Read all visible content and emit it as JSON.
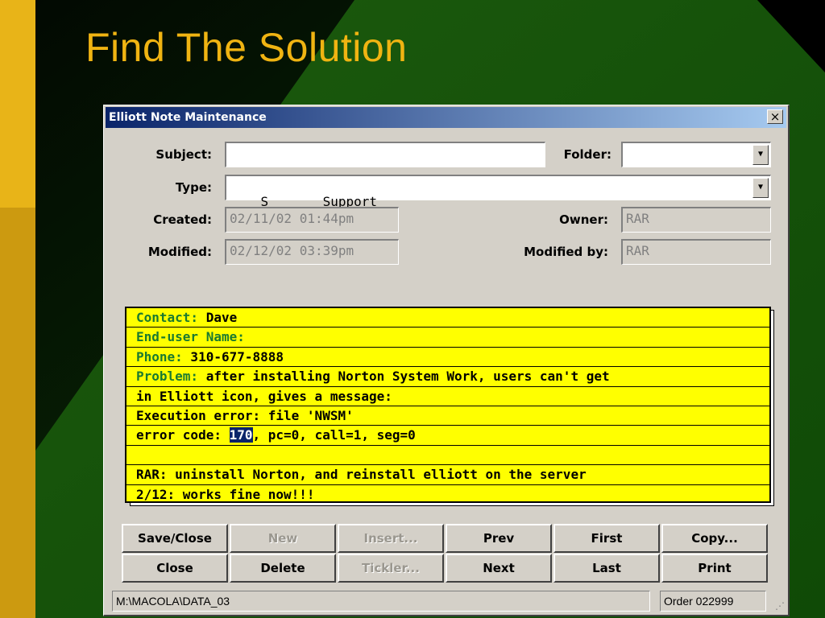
{
  "slide": {
    "title": "Find The Solution"
  },
  "window": {
    "title": "Elliott Note Maintenance",
    "close_glyph": "×"
  },
  "form": {
    "subject_label": "Subject:",
    "subject_value": "",
    "folder_label": "Folder:",
    "folder_value": "",
    "type_label": "Type:",
    "type_value": "S       Support",
    "created_label": "Created:",
    "created_value": "02/11/02 01:44pm",
    "owner_label": "Owner:",
    "owner_value": "RAR",
    "modified_label": "Modified:",
    "modified_value": "02/12/02 03:39pm",
    "modified_by_label": "Modified by:",
    "modified_by_value": "RAR"
  },
  "note": {
    "lines": [
      {
        "key": "Contact:",
        "text": " Dave"
      },
      {
        "key": "End-user Name:",
        "text": ""
      },
      {
        "key": "Phone:",
        "text": " 310-677-8888"
      },
      {
        "key": "Problem:",
        "text": " after installing Norton System Work, users can't get"
      },
      {
        "key": "",
        "text": "in Elliott icon, gives a message:"
      },
      {
        "key": "",
        "text": "Execution error: file 'NWSM'"
      },
      {
        "key": "",
        "text_before": "error code: ",
        "selected": "170",
        "text_after": ", pc=0, call=1, seg=0"
      },
      {
        "key": "",
        "text": ""
      },
      {
        "key": "",
        "text": "RAR: uninstall Norton, and reinstall elliott on the server"
      },
      {
        "key": "",
        "text": "2/12: works fine now!!!"
      }
    ]
  },
  "buttons": {
    "save_close": "Save/Close",
    "new": "New",
    "insert": "Insert...",
    "prev": "Prev",
    "first": "First",
    "copy": "Copy...",
    "close": "Close",
    "delete": "Delete",
    "tickler": "Tickler...",
    "next": "Next",
    "last": "Last",
    "print": "Print"
  },
  "status": {
    "path": "M:\\MACOLA\\DATA_03",
    "order": "Order 022999"
  },
  "colors": {
    "background": "#0a2a08",
    "accent_gold": "#f0b412",
    "note_yellow": "#ffff00",
    "note_key_green": "#1a7a30",
    "selection_blue": "#0a246a"
  },
  "icons": {
    "dropdown": "chevron-down-icon",
    "close": "close-icon",
    "resize": "resize-grip-icon"
  }
}
